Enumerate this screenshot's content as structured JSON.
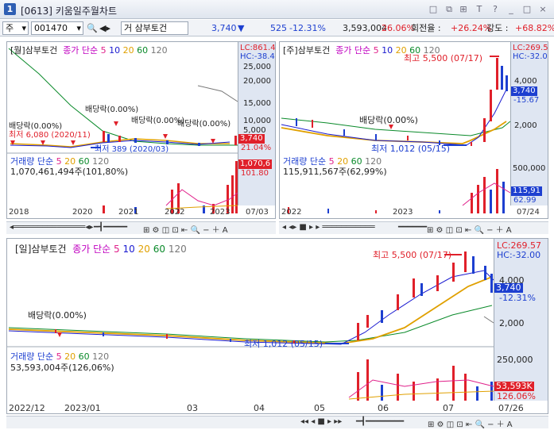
{
  "window": {
    "number": "1",
    "title": "[0613] 키움일주월차트",
    "controls": [
      "□",
      "⧉",
      "⊞",
      "T",
      "?",
      "_",
      "□",
      "×"
    ]
  },
  "toolbar": {
    "market": "주",
    "code": "001470",
    "code_prefix": "거",
    "name": "삼부토건",
    "price": "3,740",
    "change": "525",
    "change_pct": "-12.31%",
    "volume": "3,593,004",
    "volume_pct": "26.06%",
    "turnover_label": "회전율 :",
    "turnover": "+26.24%",
    "strength_label": "강도 :",
    "strength": "+68.82%"
  },
  "monthly": {
    "label": "[월]삼부토건",
    "ma_label": "종가 단순",
    "ma": [
      "5",
      "10",
      "20",
      "60",
      "120"
    ],
    "lc": "LC:861.4",
    "hc": "HC:-38.4",
    "y_ticks": [
      "25,000",
      "20,000",
      "15,000",
      "10,000",
      "5,000"
    ],
    "price_tag": "3,740",
    "pct_tag": "21.04%",
    "annotations": {
      "div1": "배당락(0.00%)",
      "div2": "배당락(0.00%)",
      "div3": "배당락(0.00%)",
      "div4": "배당락(0.00%)",
      "low": "최저 389 (2020/03)",
      "low_prev": "최저 6,080 (2020/11)",
      "overlap": "배당락(0.00%)"
    },
    "vol_label": "거래량 단순",
    "vol_ma": [
      "5",
      "20",
      "60",
      "120"
    ],
    "vol_text": "1,070,461,494주(101,80%)",
    "vol_tag": "1,070,6",
    "vol_pct_tag": "101.80",
    "x_ticks": [
      "2018",
      "2020",
      "2021",
      "2022",
      "2023",
      "07/03"
    ]
  },
  "weekly": {
    "label": "[주]삼부토건",
    "ma_label": "종가 단순",
    "ma": [
      "5",
      "10",
      "20",
      "60",
      "120"
    ],
    "lc": "LC:269.5",
    "hc": "HC:-32.0",
    "y_ticks": [
      "4,000",
      "2,000"
    ],
    "price_tag": "3,740",
    "pct_tag": "-15.67",
    "annotations": {
      "high": "최고 5,500 (07/17)",
      "div": "배당락(0.00%)",
      "low": "최저 1,012 (05/15)"
    },
    "vol_label": "거래량 단순",
    "vol_ma": [
      "5",
      "20",
      "60",
      "120"
    ],
    "vol_text": "115,911,567주(62,99%)",
    "vol_y": "500,000",
    "vol_tag": "115,91",
    "vol_pct_tag": "62.99",
    "x_ticks": [
      "2022",
      "2023",
      "07/24"
    ]
  },
  "daily": {
    "label": "[일]삼부토건",
    "ma_label": "종가 단순",
    "ma": [
      "5",
      "10",
      "20",
      "60",
      "120"
    ],
    "lc": "LC:269.57",
    "hc": "HC:-32.00",
    "y_ticks": [
      "4,000",
      "2,000"
    ],
    "price_tag": "3,740",
    "pct_tag": "-12.31%",
    "annotations": {
      "high": "최고 5,500 (07/17)",
      "div": "배당락(0.00%)",
      "low": "최저 1,012 (05/15)"
    },
    "vol_label": "거래량 단순",
    "vol_ma": [
      "5",
      "20",
      "60",
      "120"
    ],
    "vol_text": "53,593,004주(126,06%)",
    "vol_y": "250,000",
    "vol_tag": "53,593K",
    "vol_pct_tag": "126.06%",
    "x_ticks": [
      "2022/12",
      "2023/01",
      "03",
      "04",
      "05",
      "06",
      "07",
      "07/26"
    ]
  },
  "colors": {
    "up": "#e0202a",
    "down": "#1d3fd0",
    "ma5": "#e0208a",
    "ma10": "#1a1ad0",
    "ma20": "#e0a000",
    "ma60": "#0a8a2a",
    "ma120": "#777777",
    "axis_bg": "#dfe6f2"
  }
}
